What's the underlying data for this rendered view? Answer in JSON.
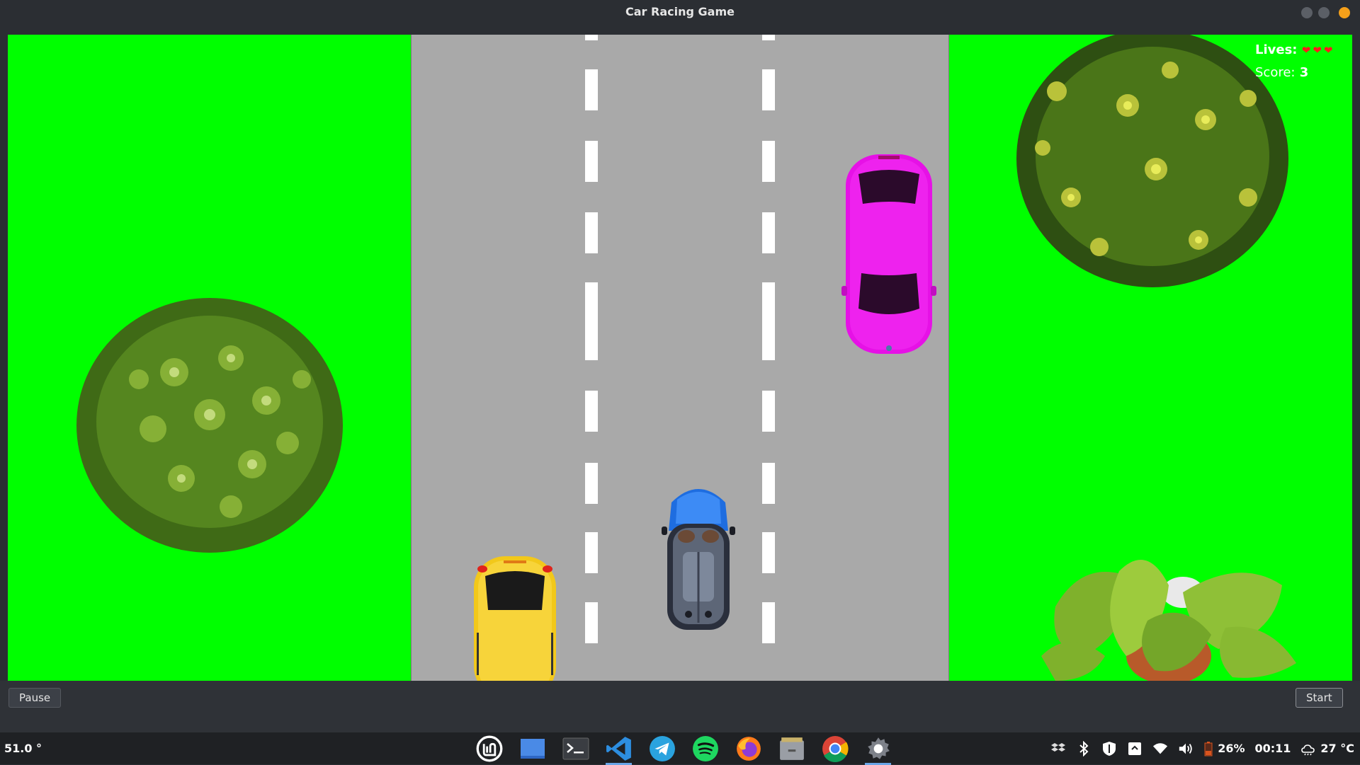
{
  "window": {
    "title": "Car Racing Game"
  },
  "hud": {
    "lives_label": "Lives:",
    "lives_count": 3,
    "lives_hearts": "❤❤❤",
    "score_label": "Score:",
    "score_value": "3"
  },
  "game_objects": {
    "player_car": {
      "color": "blue",
      "lane": 2
    },
    "enemy_cars": [
      {
        "color": "#ff00ff",
        "lane": 3
      },
      {
        "color": "#f5cc1c",
        "lane": 1
      }
    ],
    "colors": {
      "grass": "#00ff00",
      "road": "#a9a9a9",
      "lane_marking": "#ffffff"
    }
  },
  "controls": {
    "pause_label": "Pause",
    "start_label": "Start"
  },
  "taskbar": {
    "left_text": "51.0 °",
    "apps": [
      {
        "name": "mint-menu-icon"
      },
      {
        "name": "show-desktop-icon"
      },
      {
        "name": "terminal-icon"
      },
      {
        "name": "vscode-icon"
      },
      {
        "name": "telegram-icon"
      },
      {
        "name": "spotify-icon"
      },
      {
        "name": "firefox-icon"
      },
      {
        "name": "files-icon"
      },
      {
        "name": "chrome-icon"
      },
      {
        "name": "settings-icon"
      }
    ],
    "battery": "26%",
    "clock": "00:11",
    "weather": "27 °C"
  }
}
